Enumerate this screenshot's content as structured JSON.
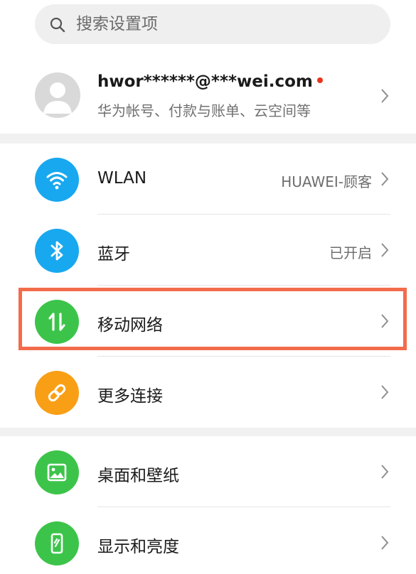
{
  "search": {
    "placeholder": "搜索设置项"
  },
  "account": {
    "name": "hwor******@***wei.com",
    "subtitle": "华为帐号、付款与账单、云空间等",
    "has_badge": true
  },
  "items": [
    {
      "label": "WLAN",
      "value": "HUAWEI-顾客",
      "icon": "wifi-icon",
      "color": "#18a8ef"
    },
    {
      "label": "蓝牙",
      "value": "已开启",
      "icon": "bluetooth-icon",
      "color": "#18a8ef"
    },
    {
      "label": "移动网络",
      "value": "",
      "icon": "mobile-data-icon",
      "color": "#3cc44a",
      "highlighted": true
    },
    {
      "label": "更多连接",
      "value": "",
      "icon": "link-icon",
      "color": "#f99f16"
    },
    {
      "label": "桌面和壁纸",
      "value": "",
      "icon": "wallpaper-icon",
      "color": "#3cc44a"
    },
    {
      "label": "显示和亮度",
      "value": "",
      "icon": "display-icon",
      "color": "#3cc44a"
    }
  ],
  "colors": {
    "highlight": "#f26c4b",
    "badge": "#e8341c"
  }
}
